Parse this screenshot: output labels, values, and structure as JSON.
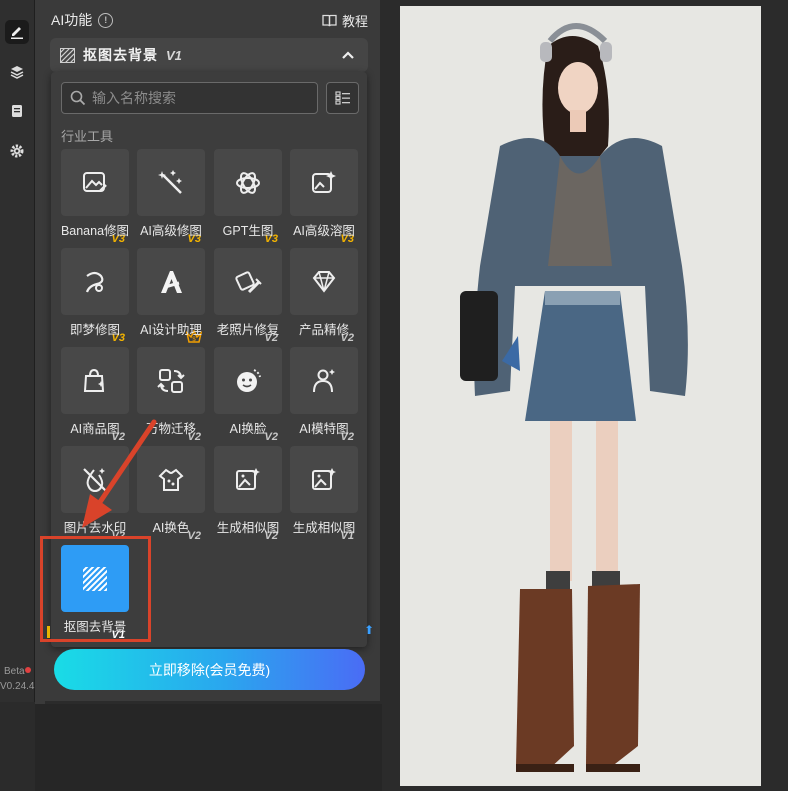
{
  "sidebar": {
    "tools": [
      "edit-pen-icon",
      "layers-icon",
      "document-icon",
      "gear-icon"
    ],
    "beta_label": "Beta",
    "version": "V0.24.4"
  },
  "panel": {
    "title": "AI功能",
    "tutorial_label": "教程",
    "section_name": "抠图去背景",
    "section_version": "V1"
  },
  "search": {
    "placeholder": "输入名称搜索",
    "value": ""
  },
  "category_label": "行业工具",
  "tools": [
    {
      "label": "Banana修图",
      "badge": "V3",
      "icon": "image-edit-icon"
    },
    {
      "label": "AI高级修图",
      "badge": "V3",
      "icon": "magic-wand-icon"
    },
    {
      "label": "GPT生图",
      "badge": "V3",
      "icon": "openai-icon"
    },
    {
      "label": "AI高级溶图",
      "badge": "V3",
      "icon": "image-sparkle-icon"
    },
    {
      "label": "即梦修图",
      "badge": "V3",
      "icon": "dream-icon"
    },
    {
      "label": "AI设计助理",
      "badge": "",
      "icon": "design-assistant-icon"
    },
    {
      "label": "老照片修复",
      "badge": "V2",
      "icon": "photo-repair-icon"
    },
    {
      "label": "产品精修",
      "badge": "V2",
      "icon": "diamond-icon"
    },
    {
      "label": "AI商品图",
      "badge": "V2",
      "icon": "shopping-bag-icon"
    },
    {
      "label": "万物迁移",
      "badge": "V2",
      "icon": "transfer-icon"
    },
    {
      "label": "AI换脸",
      "badge": "V2",
      "icon": "face-swap-icon"
    },
    {
      "label": "AI模特图",
      "badge": "V2",
      "icon": "model-icon"
    },
    {
      "label": "图片去水印",
      "badge": "V2",
      "icon": "remove-watermark-icon"
    },
    {
      "label": "AI换色",
      "badge": "V2",
      "icon": "color-palette-icon"
    },
    {
      "label": "生成相似图",
      "badge": "V2",
      "icon": "similar-image-icon"
    },
    {
      "label": "生成相似图",
      "badge": "V1",
      "icon": "similar-image-icon"
    },
    {
      "label": "抠图去背景",
      "badge": "V1",
      "icon": "cutout-stripes-icon",
      "selected": true
    }
  ],
  "cta_label": "立即移除(会员免费)",
  "colors": {
    "accent_blue": "#2e9cf5",
    "badge_gold": "#f4b400",
    "annotation_red": "#d9432a"
  }
}
